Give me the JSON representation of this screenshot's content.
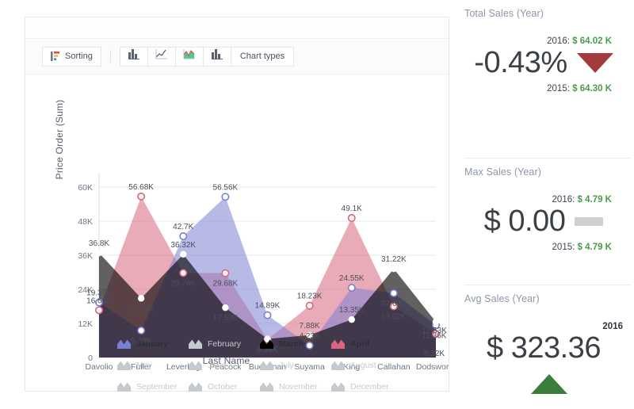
{
  "toolbar": {
    "sorting_label": "Sorting",
    "chart_types_label": "Chart types",
    "icons": [
      {
        "name": "bar-chart-icon",
        "active": false
      },
      {
        "name": "line-chart-icon",
        "active": false
      },
      {
        "name": "area-chart-icon",
        "active": true
      },
      {
        "name": "column-chart-icon",
        "active": false
      }
    ]
  },
  "chart_data": {
    "type": "area",
    "title": "",
    "xlabel": "Last Name",
    "ylabel": "Price Order (Sum)",
    "categories": [
      "Davolio",
      "Fuller",
      "Leverling",
      "Peacock",
      "Buchanan",
      "Suyama",
      "King",
      "Callahan",
      "Dodsworth"
    ],
    "ylim": [
      0,
      60000
    ],
    "yticks": [
      "0",
      "12K",
      "24K",
      "36K",
      "48K",
      "60K"
    ],
    "ytick_values": [
      0,
      12000,
      24000,
      36000,
      48000,
      60000
    ],
    "grid": true,
    "legend_position": "bottom",
    "series": [
      {
        "name": "January",
        "color": "#7b7fd4",
        "active": true,
        "values": [
          19380,
          9490,
          42700,
          56560,
          14890,
          4230,
          24550,
          22640,
          11360
        ],
        "labels": [
          "19.38K",
          "9.49K",
          "42.7K",
          "56.56K",
          "14.89K",
          "4.23K",
          "24.55K",
          "22.64K",
          "11.36K"
        ]
      },
      {
        "name": "February",
        "color": "#c6c9cd",
        "active": false,
        "values": [],
        "labels": []
      },
      {
        "name": "March",
        "color": "#c council",
        "active": true,
        "values": [
          36800,
          20830,
          36320,
          17530,
          6530,
          7880,
          13350,
          31220,
          12530
        ],
        "labels": [
          "36.8K",
          "20.83K",
          "36.32K",
          "17.53K",
          "6.53K",
          "7.88K",
          "13.35K",
          "31.22K",
          "12.53K"
        ]
      },
      {
        "name": "April",
        "color": "#d9667e",
        "active": true,
        "values": [
          16650,
          56680,
          29760,
          29680,
          6290,
          18230,
          49100,
          18020,
          8320
        ],
        "labels": [
          "16.65K",
          "56.68K",
          "29.76K",
          "29.68K",
          "6.29K",
          "18.23K",
          "49.1K",
          "18.02K",
          "8.32K"
        ]
      },
      {
        "name": "May",
        "color": "#c6c9cd",
        "active": false,
        "values": [],
        "labels": []
      },
      {
        "name": "June",
        "color": "#c6c9cd",
        "active": false,
        "values": [],
        "labels": []
      },
      {
        "name": "July",
        "color": "#c6c9cd",
        "active": false,
        "values": [],
        "labels": []
      },
      {
        "name": "August",
        "color": "#c6c9cd",
        "active": false,
        "values": [],
        "labels": []
      },
      {
        "name": "September",
        "color": "#c6c9cd",
        "active": false,
        "values": [],
        "labels": []
      },
      {
        "name": "October",
        "color": "#c6c9cd",
        "active": false,
        "values": [],
        "labels": []
      },
      {
        "name": "November",
        "color": "#c6c9cd",
        "active": false,
        "values": [],
        "labels": []
      },
      {
        "name": "December",
        "color": "#c6c9cd",
        "active": false,
        "values": [],
        "labels": []
      }
    ]
  },
  "kpis": [
    {
      "title": "Total Sales (Year)",
      "top_year": "2016:",
      "top_value": "$ 64.02 K",
      "value": "-0.43%",
      "indicator": "down",
      "bottom_year": "2015:",
      "bottom_value": "$ 64.30 K"
    },
    {
      "title": "Max Sales (Year)",
      "top_year": "2016:",
      "top_value": "$ 4.79 K",
      "value": "$ 0.00",
      "indicator": "flat",
      "bottom_year": "2015:",
      "bottom_value": "$ 4.79 K"
    },
    {
      "title": "Avg Sales (Year)",
      "year": "2016",
      "value": "$ 323.36",
      "indicator": "up"
    }
  ],
  "colors": {
    "january": "#7b7fd4",
    "march": "#cc4fd0",
    "april": "#d9667e",
    "inactive": "#c6c9cd",
    "positive": "#4a9b4a",
    "down_arrow": "#a23b3b",
    "up_arrow": "#3b7d3b"
  }
}
